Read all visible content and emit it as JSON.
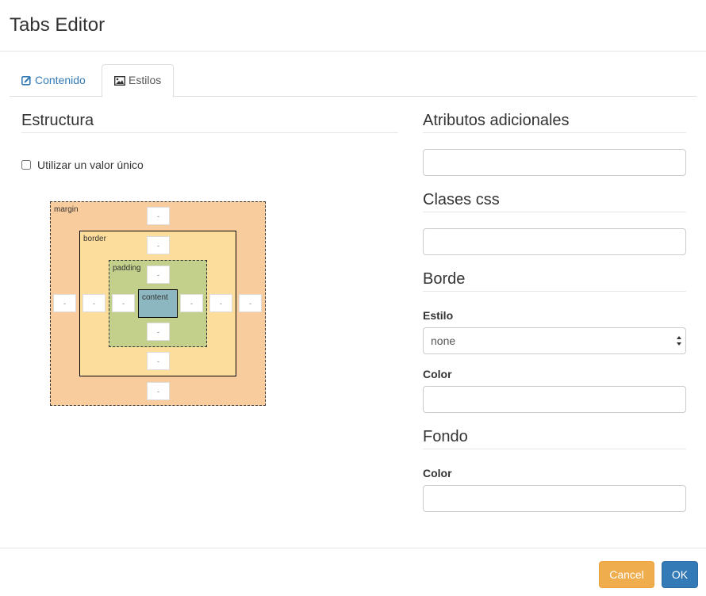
{
  "header": {
    "title": "Tabs Editor"
  },
  "tabs": [
    {
      "label": "Contenido",
      "icon": "edit-icon",
      "active": false
    },
    {
      "label": "Estilos",
      "icon": "image-icon",
      "active": true
    }
  ],
  "structure": {
    "title": "Estructura",
    "single_value_label": "Utilizar un valor único",
    "single_value_checked": false,
    "box_labels": {
      "margin": "margin",
      "border": "border",
      "padding": "padding",
      "content": "content"
    },
    "placeholder": "-"
  },
  "attributes": {
    "title": "Atributos adicionales",
    "value": ""
  },
  "css_classes": {
    "title": "Clases css",
    "value": ""
  },
  "border": {
    "title": "Borde",
    "style_label": "Estilo",
    "style_value": "none",
    "color_label": "Color",
    "color_value": ""
  },
  "background": {
    "title": "Fondo",
    "color_label": "Color",
    "color_value": ""
  },
  "footer": {
    "cancel_label": "Cancel",
    "ok_label": "OK"
  },
  "colors": {
    "primary": "#337ab7",
    "warning": "#f0ad4e",
    "margin_box": "#f9cc9d",
    "border_box": "#fddd9b",
    "padding_box": "#c3d08b",
    "content_box": "#8cb6c0"
  }
}
